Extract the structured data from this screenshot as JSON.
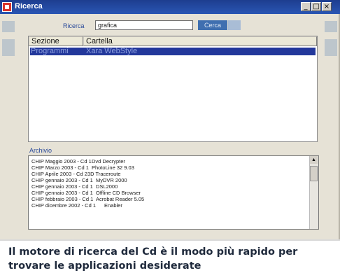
{
  "window": {
    "title": "Ricerca",
    "buttons": {
      "minimize": "_",
      "maximize": "□",
      "close": "×"
    }
  },
  "search": {
    "label": "Ricerca",
    "value": "grafica",
    "button_label": "Cerca"
  },
  "results": {
    "columns": [
      "Sezione",
      "Cartella"
    ],
    "selected_row": {
      "sezione": "Programmi",
      "cartella": "Xara WebStyle"
    }
  },
  "archive": {
    "label": "Archivio",
    "rows": [
      {
        "cd": "CHIP Maggio 2003 - Cd 1",
        "app": "Dvd Decrypter"
      },
      {
        "cd": "CHIP Marzo 2003 - Cd 1",
        "app": "PhotoLine 32 9.03"
      },
      {
        "cd": "CHIP Aprile 2003 - Cd 2",
        "app": "3D Traceroute"
      },
      {
        "cd": "CHIP gennaio 2003 - Cd 1",
        "app": "MyDVR 2000"
      },
      {
        "cd": "CHIP gennaio 2003 - Cd 1",
        "app": "DSL2000"
      },
      {
        "cd": "CHIP gennaio 2003 - Cd 1",
        "app": "Offline CD Browser"
      },
      {
        "cd": "CHIP febbraio 2003 - Cd 1",
        "app": "Acrobat Reader 5.05"
      },
      {
        "cd": "CHIP dicembre 2002 - Cd 1",
        "app": "Enabler"
      }
    ]
  },
  "caption": "Il motore di ricerca del Cd è il modo più rapido per trovare le applicazioni desiderate"
}
